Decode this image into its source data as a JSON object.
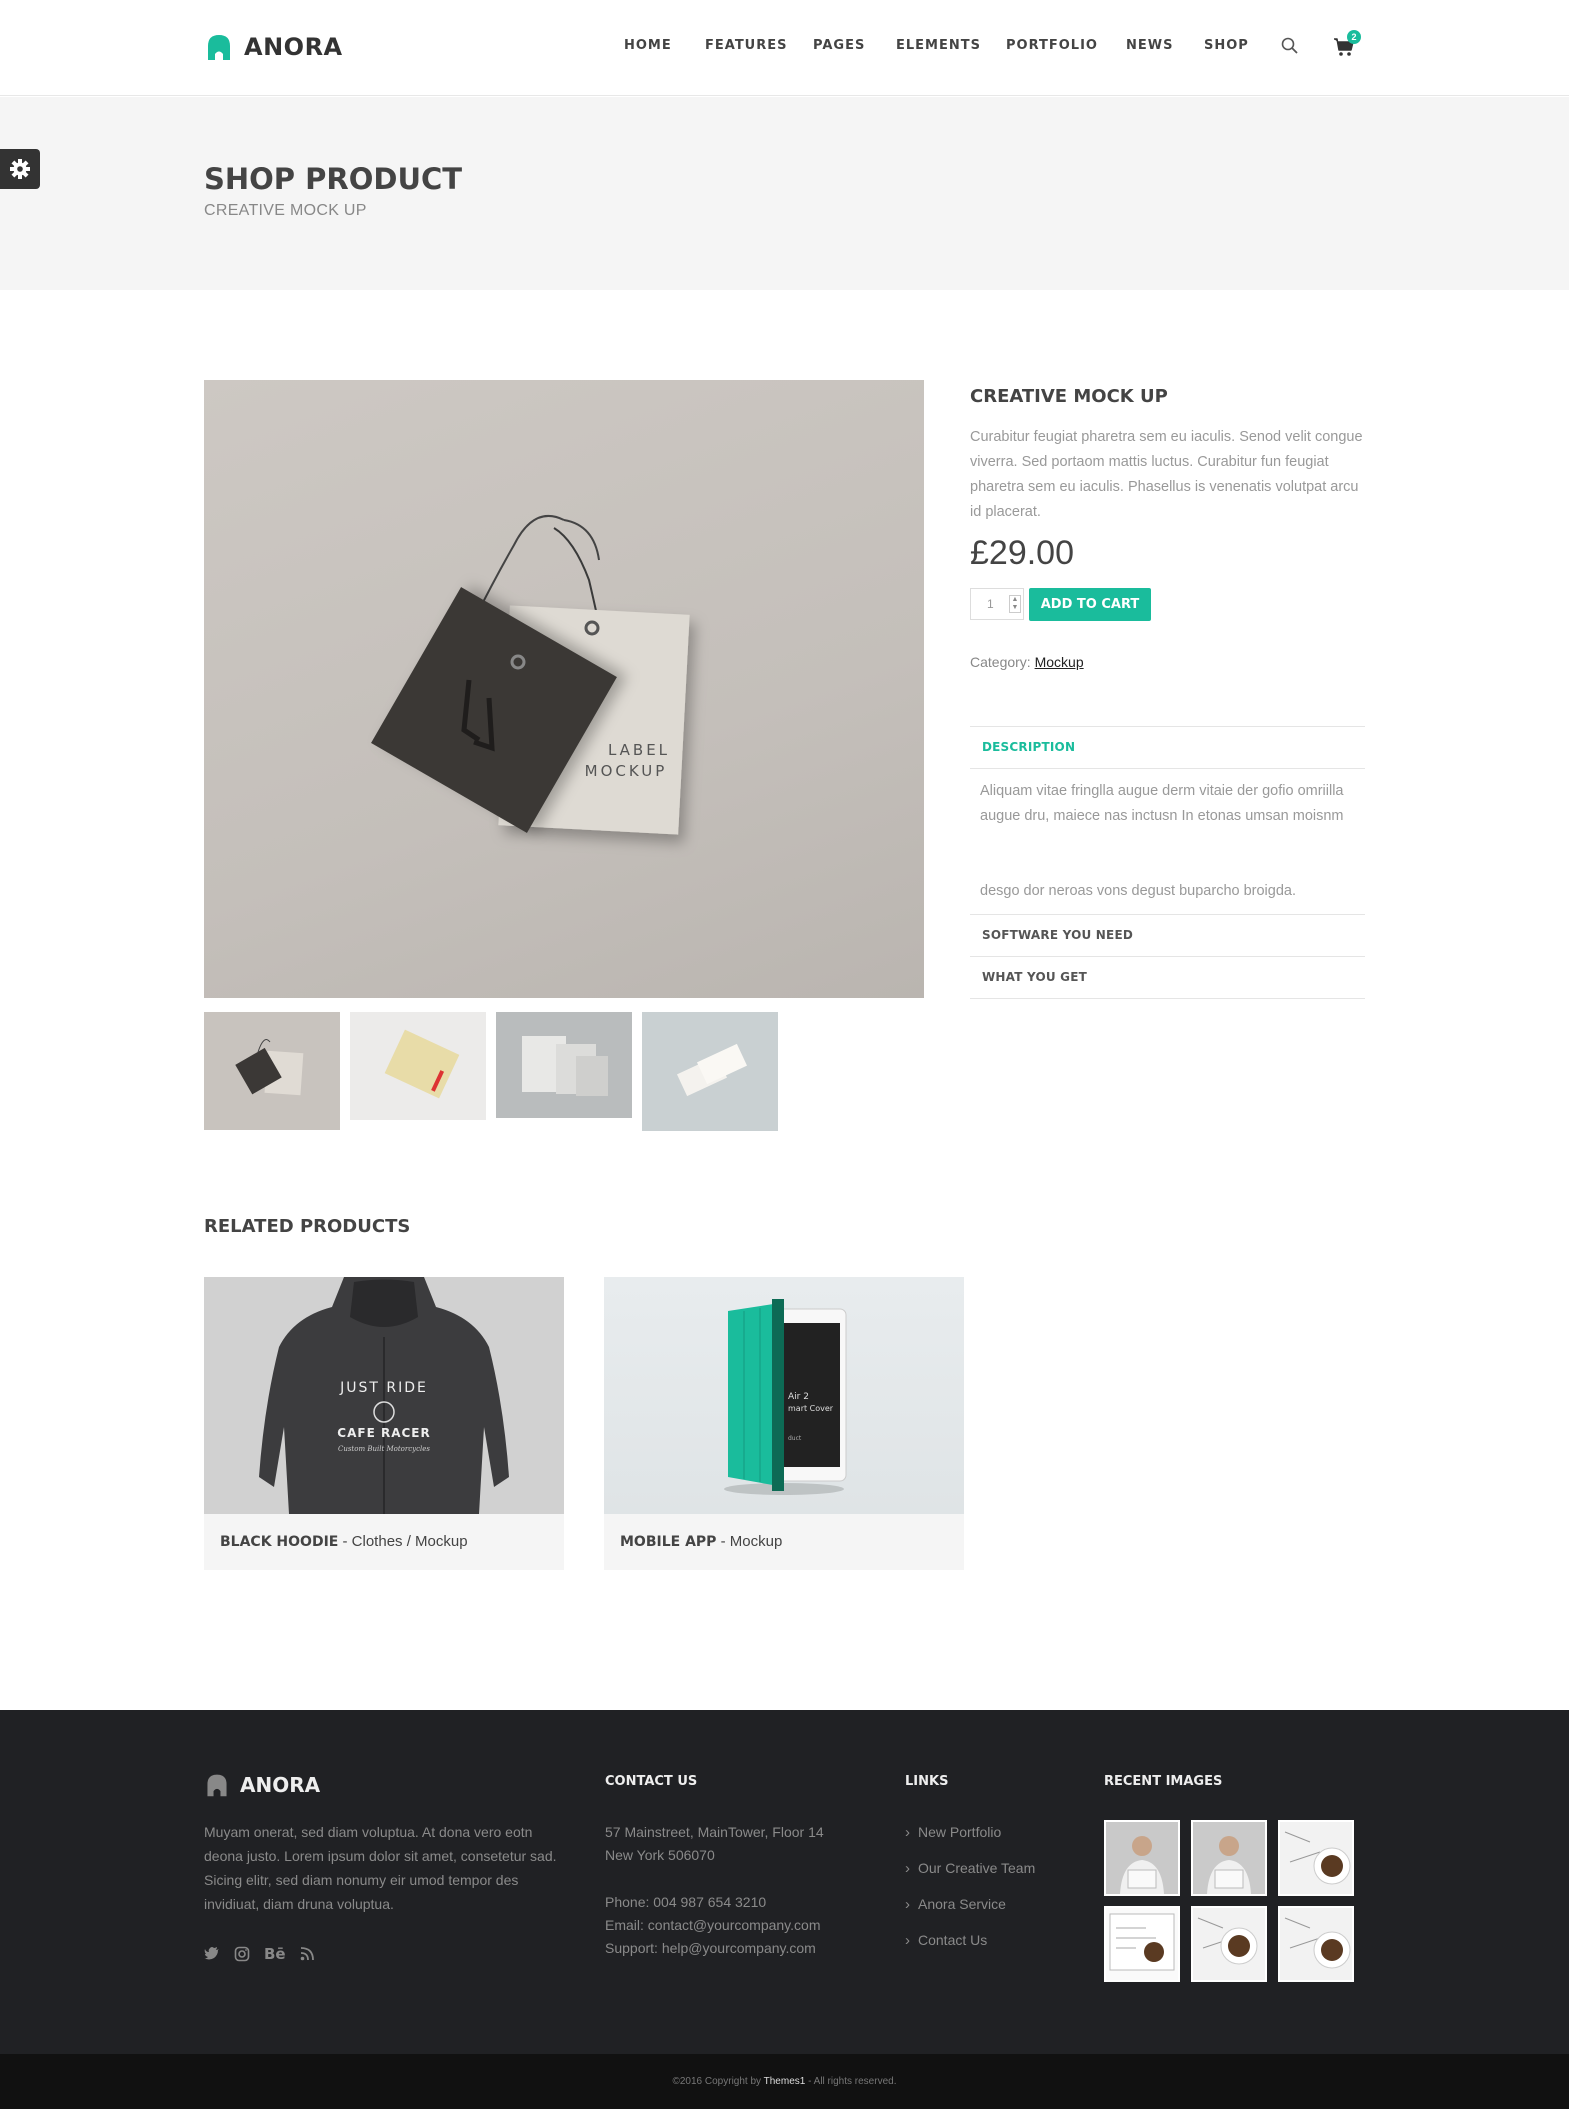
{
  "brand": {
    "name": "ANORA",
    "accent": "#1abc9c"
  },
  "nav": {
    "items": [
      "HOME",
      "FEATURES",
      "PAGES",
      "ELEMENTS",
      "PORTFOLIO",
      "NEWS",
      "SHOP"
    ],
    "cart_count": "2"
  },
  "page": {
    "title": "SHOP PRODUCT",
    "subtitle": "CREATIVE MOCK UP"
  },
  "product": {
    "name": "CREATIVE MOCK UP",
    "description": "Curabitur feugiat pharetra sem eu iaculis. Senod velit congue viverra. Sed portaom mattis luctus. Curabitur fun feugiat pharetra sem eu iaculis. Phasellus is venenatis volutpat arcu id placerat.",
    "price": "£29.00",
    "quantity": "1",
    "add_to_cart": "ADD TO CART",
    "category_label": "Category:",
    "category_value": "Mockup",
    "image_label_line1": "LABEL",
    "image_label_line2": "MOCKUP"
  },
  "tabs": [
    {
      "label": "DESCRIPTION",
      "active": true
    },
    {
      "label": "SOFTWARE YOU NEED",
      "active": false
    },
    {
      "label": "WHAT YOU GET",
      "active": false
    }
  ],
  "tab_description": {
    "para1": "Aliquam vitae fringlla augue derm vitaie der gofio omriilla augue dru, maiece nas inctusn In etonas umsan moisnm",
    "para2": "desgo dor neroas vons degust buparcho broigda."
  },
  "related": {
    "title": "RELATED PRODUCTS",
    "items": [
      {
        "name": "BLACK HOODIE",
        "meta": " - Clothes / Mockup",
        "print_line1": "JUST RIDE",
        "print_line2": "CAFE RACER",
        "print_line3": "Custom Built Motorcycles"
      },
      {
        "name": "MOBILE APP",
        "meta": " - Mockup",
        "screen_line1": "Air 2",
        "screen_line2": "mart Cover",
        "screen_line3": "duct"
      }
    ]
  },
  "footer": {
    "brand": "ANORA",
    "about": "Muyam onerat, sed diam voluptua. At dona vero eotn deona justo. Lorem ipsum dolor sit amet, consetetur sad. Sicing elitr, sed diam nonumy eir umod tempor des invidiuat, diam druna voluptua.",
    "social": [
      "twitter-icon",
      "instagram-icon",
      "behance-icon",
      "rss-icon"
    ],
    "behance_label": "Bē",
    "contact_title": "CONTACT US",
    "address1": "57 Mainstreet, MainTower, Floor 14",
    "address2": "New York 506070",
    "phone": "Phone: 004 987 654 3210",
    "email": "Email: contact@yourcompany.com",
    "support": "Support: help@yourcompany.com",
    "links_title": "LINKS",
    "links": [
      "New Portfolio",
      "Our Creative Team",
      "Anora Service",
      "Contact Us"
    ],
    "recent_title": "RECENT IMAGES"
  },
  "copyright": {
    "prefix": "©2016 Copyright by ",
    "company": "Themes1",
    "suffix": " - All rights reserved."
  }
}
